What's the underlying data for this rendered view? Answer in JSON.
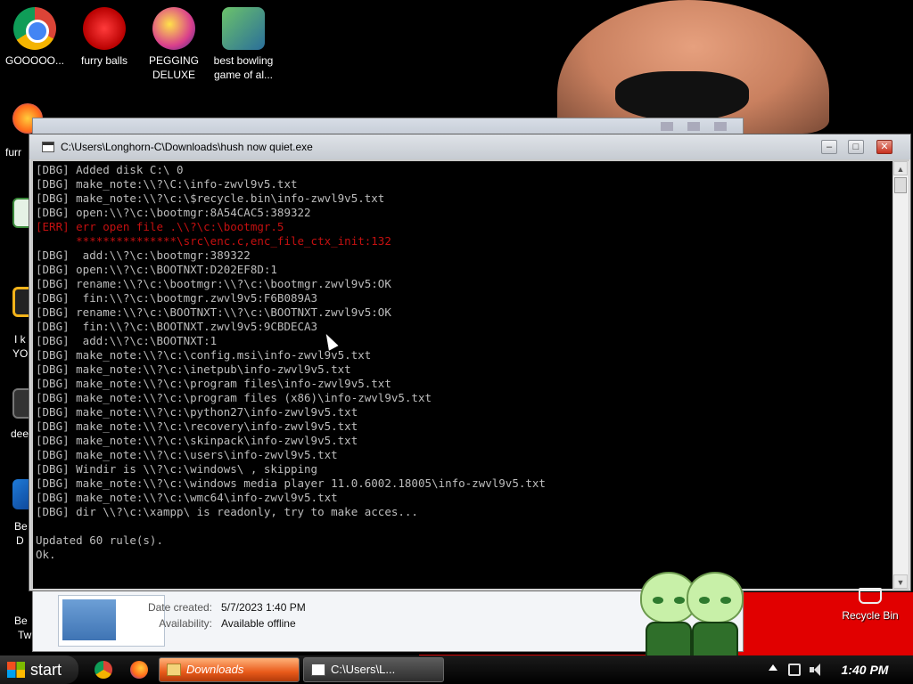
{
  "desktop": {
    "icons": [
      {
        "label": "GOOOOO...",
        "icon": "chrome-icon"
      },
      {
        "label": "furry balls",
        "icon": "furry-balls-icon"
      },
      {
        "label": "PEGGING DELUXE",
        "icon": "pegging-icon"
      },
      {
        "label": "best bowling game of al...",
        "icon": "bowling-icon"
      }
    ],
    "side_labels": [
      "furr",
      "I k",
      "YO",
      "dee",
      "Be",
      "D",
      "Be",
      "Tw"
    ],
    "recycle_bin": "Recycle Bin"
  },
  "explorer": {
    "date_created_label": "Date created:",
    "date_created_value": "5/7/2023 1:40 PM",
    "availability_label": "Availability:",
    "availability_value": "Available offline"
  },
  "console": {
    "title": "C:\\Users\\Longhorn-C\\Downloads\\hush now quiet.exe",
    "lines": [
      {
        "text": "[DBG] Added disk C:\\ 0",
        "type": "dbg"
      },
      {
        "text": "[DBG] make_note:\\\\?\\C:\\info-zwvl9v5.txt",
        "type": "dbg"
      },
      {
        "text": "[DBG] make_note:\\\\?\\c:\\$recycle.bin\\info-zwvl9v5.txt",
        "type": "dbg"
      },
      {
        "text": "[DBG] open:\\\\?\\c:\\bootmgr:8A54CAC5:389322",
        "type": "dbg"
      },
      {
        "text": "[ERR] err open file .\\\\?\\c:\\bootmgr.5",
        "type": "err"
      },
      {
        "text": "      ***************\\src\\enc.c,enc_file_ctx_init:132",
        "type": "err"
      },
      {
        "text": "[DBG]  add:\\\\?\\c:\\bootmgr:389322",
        "type": "dbg"
      },
      {
        "text": "[DBG] open:\\\\?\\c:\\BOOTNXT:D202EF8D:1",
        "type": "dbg"
      },
      {
        "text": "[DBG] rename:\\\\?\\c:\\bootmgr:\\\\?\\c:\\bootmgr.zwvl9v5:OK",
        "type": "dbg"
      },
      {
        "text": "[DBG]  fin:\\\\?\\c:\\bootmgr.zwvl9v5:F6B089A3",
        "type": "dbg"
      },
      {
        "text": "[DBG] rename:\\\\?\\c:\\BOOTNXT:\\\\?\\c:\\BOOTNXT.zwvl9v5:OK",
        "type": "dbg"
      },
      {
        "text": "[DBG]  fin:\\\\?\\c:\\BOOTNXT.zwvl9v5:9CBDECA3",
        "type": "dbg"
      },
      {
        "text": "[DBG]  add:\\\\?\\c:\\BOOTNXT:1",
        "type": "dbg"
      },
      {
        "text": "[DBG] make_note:\\\\?\\c:\\config.msi\\info-zwvl9v5.txt",
        "type": "dbg"
      },
      {
        "text": "[DBG] make_note:\\\\?\\c:\\inetpub\\info-zwvl9v5.txt",
        "type": "dbg"
      },
      {
        "text": "[DBG] make_note:\\\\?\\c:\\program files\\info-zwvl9v5.txt",
        "type": "dbg"
      },
      {
        "text": "[DBG] make_note:\\\\?\\c:\\program files (x86)\\info-zwvl9v5.txt",
        "type": "dbg"
      },
      {
        "text": "[DBG] make_note:\\\\?\\c:\\python27\\info-zwvl9v5.txt",
        "type": "dbg"
      },
      {
        "text": "[DBG] make_note:\\\\?\\c:\\recovery\\info-zwvl9v5.txt",
        "type": "dbg"
      },
      {
        "text": "[DBG] make_note:\\\\?\\c:\\skinpack\\info-zwvl9v5.txt",
        "type": "dbg"
      },
      {
        "text": "[DBG] make_note:\\\\?\\c:\\users\\info-zwvl9v5.txt",
        "type": "dbg"
      },
      {
        "text": "[DBG] Windir is \\\\?\\c:\\windows\\ , skipping",
        "type": "dbg"
      },
      {
        "text": "[DBG] make_note:\\\\?\\c:\\windows media player 11.0.6002.18005\\info-zwvl9v5.txt",
        "type": "dbg"
      },
      {
        "text": "[DBG] make_note:\\\\?\\c:\\wmc64\\info-zwvl9v5.txt",
        "type": "dbg"
      },
      {
        "text": "[DBG] dir \\\\?\\c:\\xampp\\ is readonly, try to make acces...",
        "type": "dbg"
      },
      {
        "text": "",
        "type": "dbg"
      },
      {
        "text": "Updated 60 rule(s).",
        "type": "dbg"
      },
      {
        "text": "Ok.",
        "type": "dbg"
      }
    ]
  },
  "taskbar": {
    "start_label": "start",
    "tasks": [
      {
        "label": "Downloads",
        "icon": "folder-icon",
        "active": true
      },
      {
        "label": "C:\\Users\\L...",
        "icon": "console-icon",
        "active": false
      }
    ],
    "clock": "1:40 PM"
  },
  "colors": {
    "console_text": "#bdbdbd",
    "console_error": "#c41010",
    "wallpaper_red": "#e10000"
  }
}
